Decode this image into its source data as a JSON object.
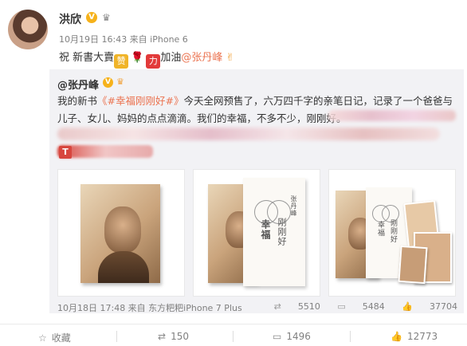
{
  "post": {
    "author": "洪欣",
    "meta": "10月19日 16:43 来自 iPhone 6",
    "text_prefix": "祝 新書大賣",
    "sticker_zan": "赞",
    "sticker_li": "力",
    "text_mid": "加油",
    "mention": "@张丹峰"
  },
  "repost": {
    "author": "@张丹峰",
    "line_a": "我的新书",
    "hashtag": "《#幸福刚刚好#》",
    "line_b": "今天全网预售了，六万四千字的亲笔日记，记录了一个爸爸与儿子、女儿、妈妈的点点滴滴。我们的幸福，不多不少，刚刚好。",
    "book_title_a": "幸福",
    "book_title_b": "刚刚好",
    "book_author": "张丹峰",
    "meta": "10月18日 17:48 来自 东方粑粑iPhone 7 Plus",
    "reposts": "5510",
    "comments": "5484",
    "likes": "37704"
  },
  "actions": {
    "favorite": "收藏",
    "repost": "150",
    "comment": "1496",
    "like": "12773"
  }
}
